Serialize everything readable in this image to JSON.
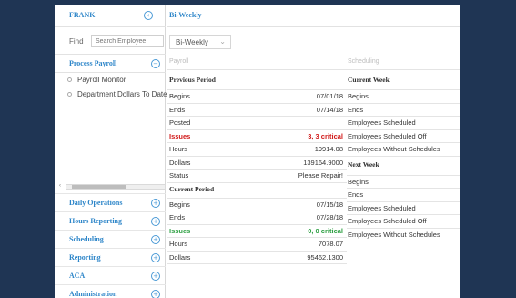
{
  "sidebar": {
    "user_name": "FRANK",
    "find_label": "Find",
    "search_placeholder": "Search Employee",
    "process_payroll": {
      "title": "Process Payroll",
      "items": [
        "Payroll Monitor",
        "Department Dollars To Date"
      ]
    },
    "nav_items": [
      "Daily Operations",
      "Hours Reporting",
      "Scheduling",
      "Reporting",
      "ACA",
      "Administration",
      "ACA"
    ]
  },
  "main": {
    "title": "Bi-Weekly",
    "period_select": "Bi-Weekly",
    "payroll_header": "Payroll",
    "scheduling_header": "Scheduling",
    "previous_period": {
      "title": "Previous Period",
      "rows": [
        {
          "label": "Begins",
          "value": "07/01/18"
        },
        {
          "label": "Ends",
          "value": "07/14/18"
        },
        {
          "label": "Posted",
          "value": ""
        },
        {
          "label": "Issues",
          "value": "3, 3 critical"
        },
        {
          "label": "Hours",
          "value": "19914.08"
        },
        {
          "label": "Dollars",
          "value": "139164.9000"
        },
        {
          "label": "Status",
          "value": "Please Repair!"
        }
      ]
    },
    "current_period": {
      "title": "Current Period",
      "rows": [
        {
          "label": "Begins",
          "value": "07/15/18"
        },
        {
          "label": "Ends",
          "value": "07/28/18"
        },
        {
          "label": "Issues",
          "value": "0, 0 critical"
        },
        {
          "label": "Hours",
          "value": "7078.07"
        },
        {
          "label": "Dollars",
          "value": "95462.1300"
        }
      ]
    },
    "current_week": {
      "title": "Current Week",
      "rows": [
        "Begins",
        "Ends",
        "Employees Scheduled",
        "Employees Scheduled Off",
        "Employees Without Schedules"
      ]
    },
    "next_week": {
      "title": "Next Week",
      "rows": [
        "Begins",
        "Ends",
        "Employees Scheduled",
        "Employees Scheduled Off",
        "Employees Without Schedules"
      ]
    }
  },
  "colors": {
    "link_blue": "#2e86c9",
    "critical_red": "#d11a1a",
    "ok_green": "#2ea043",
    "backdrop": "#1f3554"
  },
  "icons": {
    "user_toggle": "circle-arrow-icon",
    "collapse": "circle-minus-icon",
    "expand": "circle-plus-icon"
  }
}
